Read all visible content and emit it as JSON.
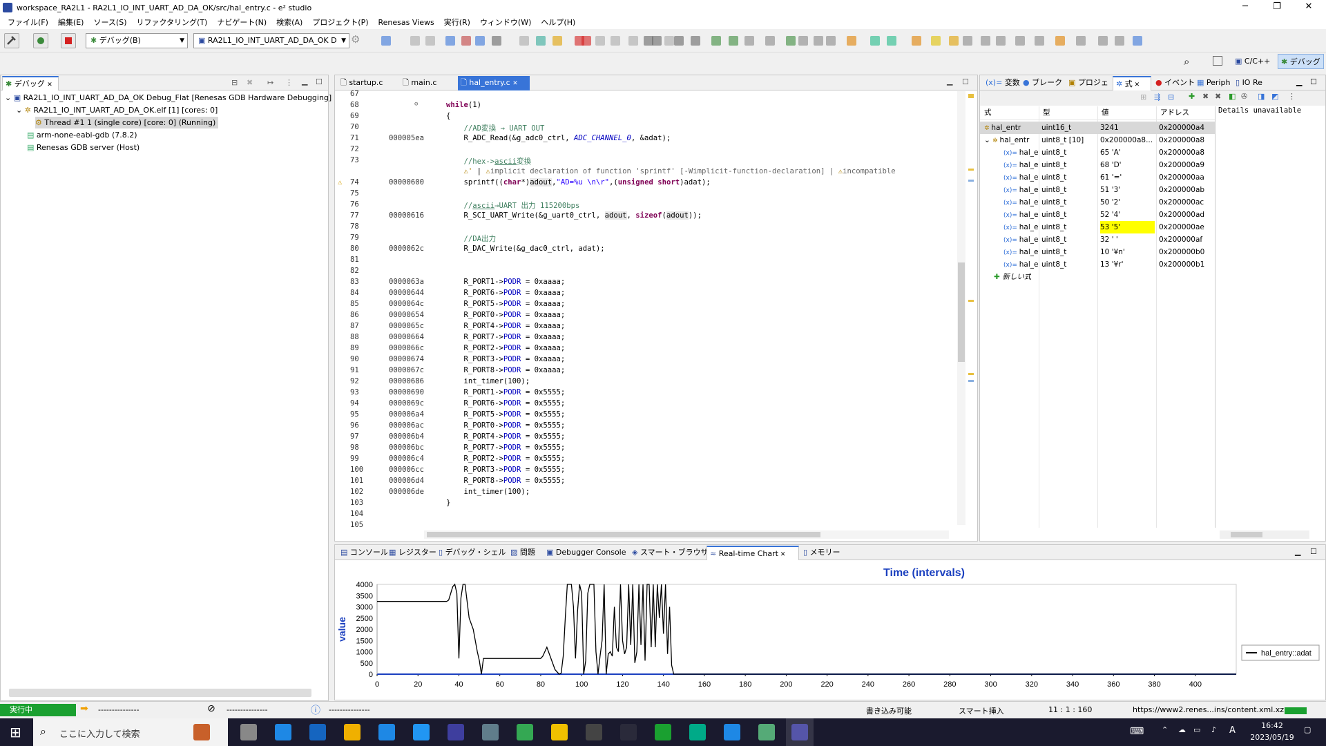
{
  "window": {
    "title": "workspace_RA2L1 - RA2L1_IO_INT_UART_AD_DA_OK/src/hal_entry.c - e² studio",
    "controls": [
      "─",
      "❐",
      "✕"
    ]
  },
  "menu": [
    "ファイル(F)",
    "編集(E)",
    "ソース(S)",
    "リファクタリング(T)",
    "ナビゲート(N)",
    "検索(A)",
    "プロジェクト(P)",
    "Renesas Views",
    "実行(R)",
    "ウィンドウ(W)",
    "ヘルプ(H)"
  ],
  "toolbar": {
    "debug_combo": "デバッグ(B)",
    "config_combo": "RA2L1_IO_INT_UART_AD_DA_OK D"
  },
  "perspectives": {
    "cpp": "C/C++",
    "debug": "デバッグ"
  },
  "debug_view": {
    "tab": "デバッグ",
    "items": [
      "RA2L1_IO_INT_UART_AD_DA_OK Debug_Flat [Renesas GDB Hardware Debugging]",
      "RA2L1_IO_INT_UART_AD_DA_OK.elf [1] [cores: 0]",
      "Thread #1 1 (single core) [core: 0] (Running)",
      "arm-none-eabi-gdb (7.8.2)",
      "Renesas GDB server (Host)"
    ]
  },
  "editor": {
    "tabs": [
      "startup.c",
      "main.c",
      "hal_entry.c"
    ],
    "lines": [
      {
        "n": "67",
        "a": "",
        "h": ""
      },
      {
        "n": "68",
        "a": "",
        "h": "<span class=kw>while</span>(1)"
      },
      {
        "n": "69",
        "a": "",
        "h": "{"
      },
      {
        "n": "70",
        "a": "",
        "h": "    <span class=cm>//AD変換 → UART OUT</span>"
      },
      {
        "n": "71",
        "a": "000005ea",
        "h": "    R_ADC_Read(&amp;g_adc0_ctrl, <span class=it>ADC_CHANNEL_0</span>, &amp;adat);"
      },
      {
        "n": "72",
        "a": "",
        "h": ""
      },
      {
        "n": "73",
        "a": "",
        "h": "    <span class=cm>//hex-&gt;<u>ascii</u>変換</span>"
      },
      {
        "n": "",
        "a": "",
        "h": "    <span style='color:#b08000'>⚠'</span> | <span style='color:#b08000'>⚠</span><span style='color:#666'>implicit declaration of function 'sprintf' [-Wimplicit-function-declaration] | </span><span style='color:#b08000'>⚠</span><span style='color:#666'>incompatible</span>"
      },
      {
        "n": "74",
        "a": "00000600",
        "h": "    sprintf((<span class=kw>char</span>*)<span class=hl>adout</span>,<span class=str>\"AD=%u \\n\\r\"</span>,(<span class=kw>unsigned short</span>)adat);"
      },
      {
        "n": "75",
        "a": "",
        "h": ""
      },
      {
        "n": "76",
        "a": "",
        "h": "    <span class=cm>//<u>ascii</u>→UART 出力 115200bps</span>"
      },
      {
        "n": "77",
        "a": "00000616",
        "h": "    R_SCI_UART_Write(&amp;g_uart0_ctrl, <span class=hl>adout</span>, <span class=kw>sizeof</span>(<span class=hl>adout</span>));"
      },
      {
        "n": "78",
        "a": "",
        "h": ""
      },
      {
        "n": "79",
        "a": "",
        "h": "    <span class=cm>//DA出力</span>"
      },
      {
        "n": "80",
        "a": "0000062c",
        "h": "    R_DAC_Write(&amp;g_dac0_ctrl, adat);"
      },
      {
        "n": "81",
        "a": "",
        "h": ""
      },
      {
        "n": "82",
        "a": "",
        "h": ""
      },
      {
        "n": "83",
        "a": "0000063a",
        "h": "    R_PORT1-&gt;<span class=fld>PODR</span> = 0xaaaa;"
      },
      {
        "n": "84",
        "a": "00000644",
        "h": "    R_PORT6-&gt;<span class=fld>PODR</span> = 0xaaaa;"
      },
      {
        "n": "85",
        "a": "0000064c",
        "h": "    R_PORT5-&gt;<span class=fld>PODR</span> = 0xaaaa;"
      },
      {
        "n": "86",
        "a": "00000654",
        "h": "    R_PORT0-&gt;<span class=fld>PODR</span> = 0xaaaa;"
      },
      {
        "n": "87",
        "a": "0000065c",
        "h": "    R_PORT4-&gt;<span class=fld>PODR</span> = 0xaaaa;"
      },
      {
        "n": "88",
        "a": "00000664",
        "h": "    R_PORT7-&gt;<span class=fld>PODR</span> = 0xaaaa;"
      },
      {
        "n": "89",
        "a": "0000066c",
        "h": "    R_PORT2-&gt;<span class=fld>PODR</span> = 0xaaaa;"
      },
      {
        "n": "90",
        "a": "00000674",
        "h": "    R_PORT3-&gt;<span class=fld>PODR</span> = 0xaaaa;"
      },
      {
        "n": "91",
        "a": "0000067c",
        "h": "    R_PORT8-&gt;<span class=fld>PODR</span> = 0xaaaa;"
      },
      {
        "n": "92",
        "a": "00000686",
        "h": "    int_timer(100);"
      },
      {
        "n": "93",
        "a": "00000690",
        "h": "    R_PORT1-&gt;<span class=fld>PODR</span> = 0x5555;"
      },
      {
        "n": "94",
        "a": "0000069c",
        "h": "    R_PORT6-&gt;<span class=fld>PODR</span> = 0x5555;"
      },
      {
        "n": "95",
        "a": "000006a4",
        "h": "    R_PORT5-&gt;<span class=fld>PODR</span> = 0x5555;"
      },
      {
        "n": "96",
        "a": "000006ac",
        "h": "    R_PORT0-&gt;<span class=fld>PODR</span> = 0x5555;"
      },
      {
        "n": "97",
        "a": "000006b4",
        "h": "    R_PORT4-&gt;<span class=fld>PODR</span> = 0x5555;"
      },
      {
        "n": "98",
        "a": "000006bc",
        "h": "    R_PORT7-&gt;<span class=fld>PODR</span> = 0x5555;"
      },
      {
        "n": "99",
        "a": "000006c4",
        "h": "    R_PORT2-&gt;<span class=fld>PODR</span> = 0x5555;"
      },
      {
        "n": "100",
        "a": "000006cc",
        "h": "    R_PORT3-&gt;<span class=fld>PODR</span> = 0x5555;"
      },
      {
        "n": "101",
        "a": "000006d4",
        "h": "    R_PORT8-&gt;<span class=fld>PODR</span> = 0x5555;"
      },
      {
        "n": "102",
        "a": "000006de",
        "h": "    int_timer(100);"
      },
      {
        "n": "103",
        "a": "",
        "h": "}"
      },
      {
        "n": "104",
        "a": "",
        "h": ""
      },
      {
        "n": "105",
        "a": "",
        "h": ""
      }
    ]
  },
  "right_tabs": [
    "変数",
    "ブレーク",
    "プロジェ",
    "式",
    "イベント",
    "Periph",
    "IO Re"
  ],
  "expressions": {
    "headers": [
      "式",
      "型",
      "値",
      "アドレス"
    ],
    "details": "Details unavailable",
    "rows": [
      {
        "name": "hal_entr",
        "type": "uint16_t",
        "value": "3241",
        "addr": "0x200000a4",
        "level": 0
      },
      {
        "name": "hal_entr",
        "type": "uint8_t [10]",
        "value": "0x200000a8...",
        "addr": "0x200000a8",
        "level": 0
      },
      {
        "name": "hal_e",
        "type": "uint8_t",
        "value": "65 'A'",
        "addr": "0x200000a8",
        "level": 1
      },
      {
        "name": "hal_e",
        "type": "uint8_t",
        "value": "68 'D'",
        "addr": "0x200000a9",
        "level": 1
      },
      {
        "name": "hal_e",
        "type": "uint8_t",
        "value": "61 '='",
        "addr": "0x200000aa",
        "level": 1
      },
      {
        "name": "hal_e",
        "type": "uint8_t",
        "value": "51 '3'",
        "addr": "0x200000ab",
        "level": 1
      },
      {
        "name": "hal_e",
        "type": "uint8_t",
        "value": "50 '2'",
        "addr": "0x200000ac",
        "level": 1
      },
      {
        "name": "hal_e",
        "type": "uint8_t",
        "value": "52 '4'",
        "addr": "0x200000ad",
        "level": 1
      },
      {
        "name": "hal_e",
        "type": "uint8_t",
        "value": "53 '5'",
        "addr": "0x200000ae",
        "level": 1
      },
      {
        "name": "hal_e",
        "type": "uint8_t",
        "value": "32 ' '",
        "addr": "0x200000af",
        "level": 1
      },
      {
        "name": "hal_e",
        "type": "uint8_t",
        "value": "10 '¥n'",
        "addr": "0x200000b0",
        "level": 1
      },
      {
        "name": "hal_e",
        "type": "uint8_t",
        "value": "13 '¥r'",
        "addr": "0x200000b1",
        "level": 1
      }
    ],
    "new_expr": "新しい式",
    "highlight_color": "#ffff00"
  },
  "bottom_tabs": [
    "コンソール",
    "レジスター",
    "デバッグ・シェル",
    "問題",
    "Debugger Console",
    "スマート・ブラウザー",
    "Real-time Chart",
    "メモリー"
  ],
  "chart_data": {
    "type": "line",
    "title": "Time (intervals)",
    "ylabel": "value",
    "xlim": [
      0,
      420
    ],
    "ylim": [
      0,
      4000
    ],
    "xticks": [
      0,
      20,
      40,
      60,
      80,
      100,
      120,
      140,
      160,
      180,
      200,
      220,
      240,
      260,
      280,
      300,
      320,
      340,
      360,
      380,
      400
    ],
    "yticks": [
      0,
      500,
      1000,
      1500,
      2000,
      2500,
      3000,
      3500,
      4000
    ],
    "legend": "hal_entry::adat",
    "series": [
      {
        "name": "hal_entry::adat",
        "color": "#000000",
        "points": [
          [
            0,
            3240
          ],
          [
            34,
            3240
          ],
          [
            35,
            3300
          ],
          [
            37,
            3900
          ],
          [
            38,
            4000
          ],
          [
            39,
            3600
          ],
          [
            40,
            700
          ],
          [
            41,
            3400
          ],
          [
            42,
            4000
          ],
          [
            43,
            4000
          ],
          [
            45,
            2500
          ],
          [
            47,
            2000
          ],
          [
            49,
            1000
          ],
          [
            50,
            600
          ],
          [
            51,
            0
          ],
          [
            52,
            700
          ],
          [
            80,
            700
          ],
          [
            81,
            800
          ],
          [
            83,
            1200
          ],
          [
            85,
            700
          ],
          [
            87,
            200
          ],
          [
            89,
            0
          ],
          [
            90,
            50
          ],
          [
            91,
            800
          ],
          [
            92,
            2500
          ],
          [
            93,
            4000
          ],
          [
            95,
            4000
          ],
          [
            96,
            3000
          ],
          [
            97,
            700
          ],
          [
            98,
            2800
          ],
          [
            99,
            4000
          ],
          [
            100,
            3600
          ],
          [
            101,
            0
          ],
          [
            102,
            600
          ],
          [
            103,
            3600
          ],
          [
            104,
            4000
          ],
          [
            106,
            4000
          ],
          [
            107,
            1000
          ],
          [
            108,
            0
          ],
          [
            109,
            800
          ],
          [
            110,
            1500
          ],
          [
            111,
            4000
          ],
          [
            112,
            0
          ],
          [
            113,
            900
          ],
          [
            114,
            1000
          ],
          [
            115,
            800
          ],
          [
            116,
            3000
          ],
          [
            117,
            1200
          ],
          [
            118,
            1000
          ],
          [
            119,
            4000
          ],
          [
            120,
            1500
          ],
          [
            121,
            900
          ],
          [
            122,
            1200
          ],
          [
            123,
            4000
          ],
          [
            124,
            1300
          ],
          [
            125,
            4000
          ],
          [
            126,
            500
          ],
          [
            127,
            1000
          ],
          [
            128,
            4000
          ],
          [
            129,
            1300
          ],
          [
            130,
            4000
          ],
          [
            131,
            600
          ],
          [
            132,
            4000
          ],
          [
            133,
            4000
          ],
          [
            134,
            1200
          ],
          [
            135,
            4000
          ],
          [
            136,
            1200
          ],
          [
            137,
            4000
          ],
          [
            138,
            2500
          ],
          [
            139,
            4000
          ],
          [
            140,
            1800
          ],
          [
            141,
            4000
          ],
          [
            142,
            900
          ],
          [
            143,
            3000
          ],
          [
            144,
            400
          ],
          [
            145,
            0
          ],
          [
            146,
            0
          ],
          [
            147,
            0
          ],
          [
            420,
            0
          ]
        ]
      }
    ]
  },
  "status": {
    "state": "実行中",
    "dashes": "---------------",
    "writable": "書き込み可能",
    "insert": "スマート挿入",
    "pos": "11 : 1 : 160",
    "url": "https://www2.renes...ins/content.xml.xz"
  },
  "taskbar": {
    "search": "ここに入力して検索",
    "time": "16:42",
    "date": "2023/05/19",
    "ime": "A"
  }
}
